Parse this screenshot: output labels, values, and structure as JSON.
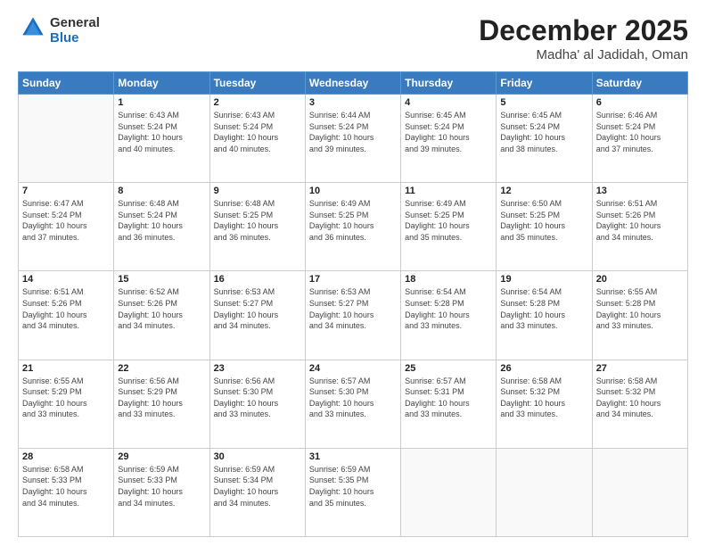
{
  "logo": {
    "general": "General",
    "blue": "Blue"
  },
  "header": {
    "title": "December 2025",
    "subtitle": "Madha' al Jadidah, Oman"
  },
  "weekdays": [
    "Sunday",
    "Monday",
    "Tuesday",
    "Wednesday",
    "Thursday",
    "Friday",
    "Saturday"
  ],
  "weeks": [
    [
      {
        "day": "",
        "info": ""
      },
      {
        "day": "1",
        "info": "Sunrise: 6:43 AM\nSunset: 5:24 PM\nDaylight: 10 hours\nand 40 minutes."
      },
      {
        "day": "2",
        "info": "Sunrise: 6:43 AM\nSunset: 5:24 PM\nDaylight: 10 hours\nand 40 minutes."
      },
      {
        "day": "3",
        "info": "Sunrise: 6:44 AM\nSunset: 5:24 PM\nDaylight: 10 hours\nand 39 minutes."
      },
      {
        "day": "4",
        "info": "Sunrise: 6:45 AM\nSunset: 5:24 PM\nDaylight: 10 hours\nand 39 minutes."
      },
      {
        "day": "5",
        "info": "Sunrise: 6:45 AM\nSunset: 5:24 PM\nDaylight: 10 hours\nand 38 minutes."
      },
      {
        "day": "6",
        "info": "Sunrise: 6:46 AM\nSunset: 5:24 PM\nDaylight: 10 hours\nand 37 minutes."
      }
    ],
    [
      {
        "day": "7",
        "info": "Sunrise: 6:47 AM\nSunset: 5:24 PM\nDaylight: 10 hours\nand 37 minutes."
      },
      {
        "day": "8",
        "info": "Sunrise: 6:48 AM\nSunset: 5:24 PM\nDaylight: 10 hours\nand 36 minutes."
      },
      {
        "day": "9",
        "info": "Sunrise: 6:48 AM\nSunset: 5:25 PM\nDaylight: 10 hours\nand 36 minutes."
      },
      {
        "day": "10",
        "info": "Sunrise: 6:49 AM\nSunset: 5:25 PM\nDaylight: 10 hours\nand 36 minutes."
      },
      {
        "day": "11",
        "info": "Sunrise: 6:49 AM\nSunset: 5:25 PM\nDaylight: 10 hours\nand 35 minutes."
      },
      {
        "day": "12",
        "info": "Sunrise: 6:50 AM\nSunset: 5:25 PM\nDaylight: 10 hours\nand 35 minutes."
      },
      {
        "day": "13",
        "info": "Sunrise: 6:51 AM\nSunset: 5:26 PM\nDaylight: 10 hours\nand 34 minutes."
      }
    ],
    [
      {
        "day": "14",
        "info": "Sunrise: 6:51 AM\nSunset: 5:26 PM\nDaylight: 10 hours\nand 34 minutes."
      },
      {
        "day": "15",
        "info": "Sunrise: 6:52 AM\nSunset: 5:26 PM\nDaylight: 10 hours\nand 34 minutes."
      },
      {
        "day": "16",
        "info": "Sunrise: 6:53 AM\nSunset: 5:27 PM\nDaylight: 10 hours\nand 34 minutes."
      },
      {
        "day": "17",
        "info": "Sunrise: 6:53 AM\nSunset: 5:27 PM\nDaylight: 10 hours\nand 34 minutes."
      },
      {
        "day": "18",
        "info": "Sunrise: 6:54 AM\nSunset: 5:28 PM\nDaylight: 10 hours\nand 33 minutes."
      },
      {
        "day": "19",
        "info": "Sunrise: 6:54 AM\nSunset: 5:28 PM\nDaylight: 10 hours\nand 33 minutes."
      },
      {
        "day": "20",
        "info": "Sunrise: 6:55 AM\nSunset: 5:28 PM\nDaylight: 10 hours\nand 33 minutes."
      }
    ],
    [
      {
        "day": "21",
        "info": "Sunrise: 6:55 AM\nSunset: 5:29 PM\nDaylight: 10 hours\nand 33 minutes."
      },
      {
        "day": "22",
        "info": "Sunrise: 6:56 AM\nSunset: 5:29 PM\nDaylight: 10 hours\nand 33 minutes."
      },
      {
        "day": "23",
        "info": "Sunrise: 6:56 AM\nSunset: 5:30 PM\nDaylight: 10 hours\nand 33 minutes."
      },
      {
        "day": "24",
        "info": "Sunrise: 6:57 AM\nSunset: 5:30 PM\nDaylight: 10 hours\nand 33 minutes."
      },
      {
        "day": "25",
        "info": "Sunrise: 6:57 AM\nSunset: 5:31 PM\nDaylight: 10 hours\nand 33 minutes."
      },
      {
        "day": "26",
        "info": "Sunrise: 6:58 AM\nSunset: 5:32 PM\nDaylight: 10 hours\nand 33 minutes."
      },
      {
        "day": "27",
        "info": "Sunrise: 6:58 AM\nSunset: 5:32 PM\nDaylight: 10 hours\nand 34 minutes."
      }
    ],
    [
      {
        "day": "28",
        "info": "Sunrise: 6:58 AM\nSunset: 5:33 PM\nDaylight: 10 hours\nand 34 minutes."
      },
      {
        "day": "29",
        "info": "Sunrise: 6:59 AM\nSunset: 5:33 PM\nDaylight: 10 hours\nand 34 minutes."
      },
      {
        "day": "30",
        "info": "Sunrise: 6:59 AM\nSunset: 5:34 PM\nDaylight: 10 hours\nand 34 minutes."
      },
      {
        "day": "31",
        "info": "Sunrise: 6:59 AM\nSunset: 5:35 PM\nDaylight: 10 hours\nand 35 minutes."
      },
      {
        "day": "",
        "info": ""
      },
      {
        "day": "",
        "info": ""
      },
      {
        "day": "",
        "info": ""
      }
    ]
  ]
}
